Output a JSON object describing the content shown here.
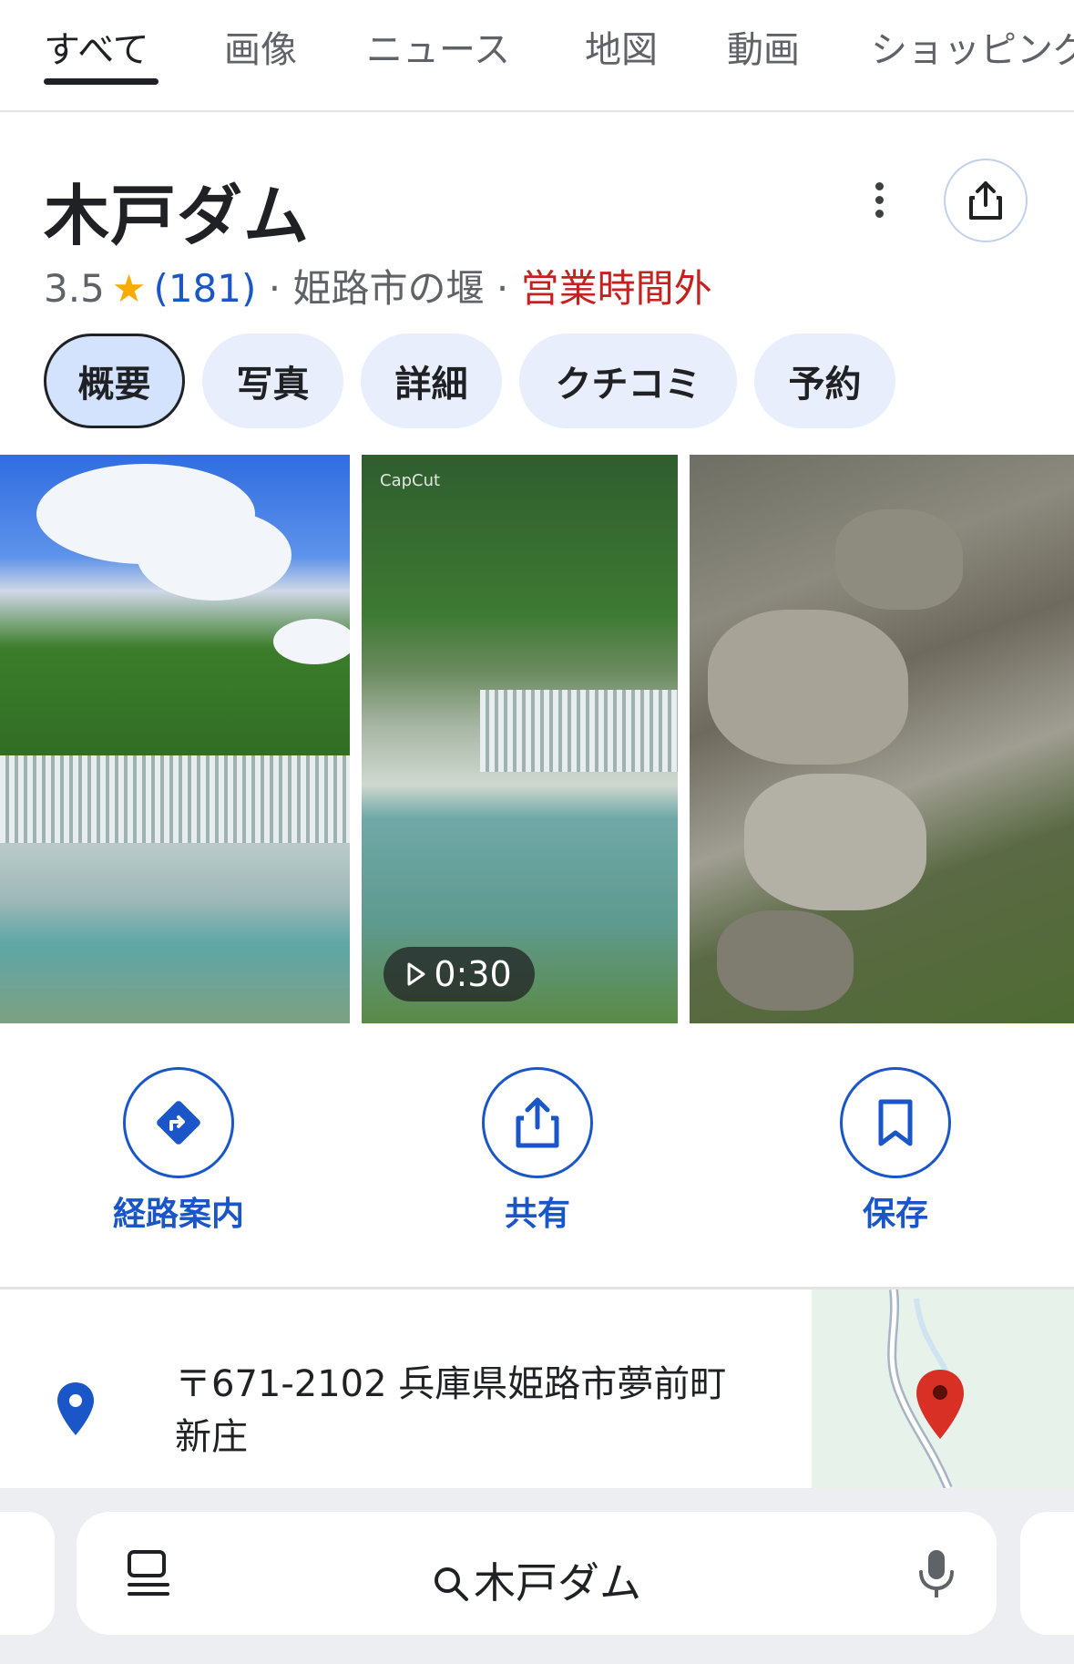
{
  "tabs": [
    "すべて",
    "画像",
    "ニュース",
    "地図",
    "動画",
    "ショッピング"
  ],
  "place": {
    "name": "木戸ダム",
    "rating": "3.5",
    "review_count": "(181)",
    "category": "姫路市の堰",
    "status": "営業時間外",
    "separator": "·"
  },
  "chips": [
    "概要",
    "写真",
    "詳細",
    "クチコミ",
    "予約"
  ],
  "photos": {
    "video_duration": "0:30",
    "watermark": "CapCut"
  },
  "actions": {
    "directions": "経路案内",
    "share": "共有",
    "save": "保存"
  },
  "address": "〒671-2102 兵庫県姫路市夢前町新庄",
  "search": {
    "query": "木戸ダム"
  },
  "colors": {
    "accent": "#1a56c8",
    "closed": "#c5221f",
    "star": "#f9ab00",
    "pin": "#1a56c8",
    "map_pin": "#d93025"
  }
}
